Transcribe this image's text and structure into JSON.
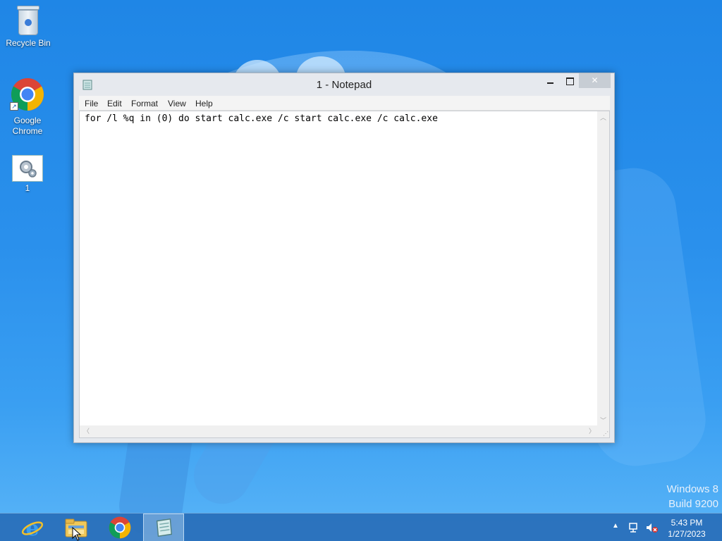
{
  "desktop": {
    "icons": [
      {
        "label": "Recycle Bin",
        "icon": "recycle-bin-icon"
      },
      {
        "label": "Google Chrome",
        "icon": "chrome-icon"
      },
      {
        "label": "1",
        "icon": "file-settings-icon"
      }
    ],
    "watermark": {
      "line1": "Windows 8",
      "line2": "Build 9200"
    }
  },
  "notepad": {
    "title": "1 - Notepad",
    "menu": [
      "File",
      "Edit",
      "Format",
      "View",
      "Help"
    ],
    "content": "for /l %q in (0) do start calc.exe /c start calc.exe /c calc.exe",
    "controls": {
      "minimize": "minimize-icon",
      "maximize": "maximize-icon",
      "close": "close-icon",
      "close_glyph": "✕"
    }
  },
  "taskbar": {
    "apps": [
      {
        "name": "Internet Explorer",
        "icon": "internet-explorer-icon"
      },
      {
        "name": "File Explorer",
        "icon": "file-explorer-icon"
      },
      {
        "name": "Google Chrome",
        "icon": "chrome-icon"
      },
      {
        "name": "Notepad",
        "icon": "notepad-icon",
        "active": true
      }
    ],
    "tray": {
      "chevron": "▲",
      "time": "5:43 PM",
      "date": "1/27/2023"
    }
  },
  "colors": {
    "desktop_bg": "#2a90ec",
    "taskbar_bg": "#286eb9",
    "close_button": "#c7cdd4"
  }
}
